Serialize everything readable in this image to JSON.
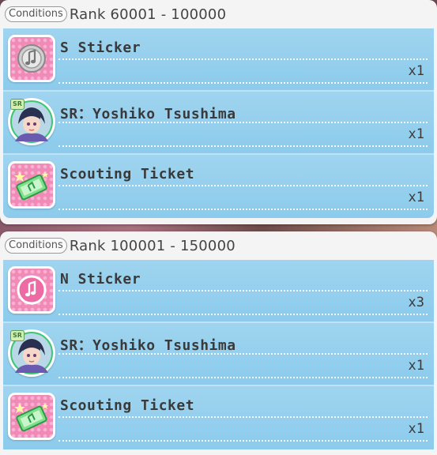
{
  "panels": [
    {
      "badge": "Conditions",
      "rank": "Rank 60001 - 100000",
      "items": [
        {
          "title": "S Sticker",
          "qty": "x1"
        },
        {
          "title": "SR：Yoshiko Tsushima",
          "qty": "x1"
        },
        {
          "title": "Scouting Ticket",
          "qty": "x1"
        }
      ]
    },
    {
      "badge": "Conditions",
      "rank": "Rank 100001 - 150000",
      "items": [
        {
          "title": "N Sticker",
          "qty": "x3"
        },
        {
          "title": "SR：Yoshiko Tsushima",
          "qty": "x1"
        },
        {
          "title": "Scouting Ticket",
          "qty": "x1"
        }
      ]
    }
  ],
  "icons": {
    "s_sticker": "silver-music-note-sticker-icon",
    "n_sticker": "pink-music-note-sticker-icon",
    "card": "yoshiko-tsushima-card-icon",
    "ticket": "scouting-ticket-icon",
    "rarity_tag": "SR"
  },
  "colors": {
    "row_bg": "#8ccbec",
    "icon_pink": "#f28ab8",
    "card_frame": "#3cc870"
  }
}
